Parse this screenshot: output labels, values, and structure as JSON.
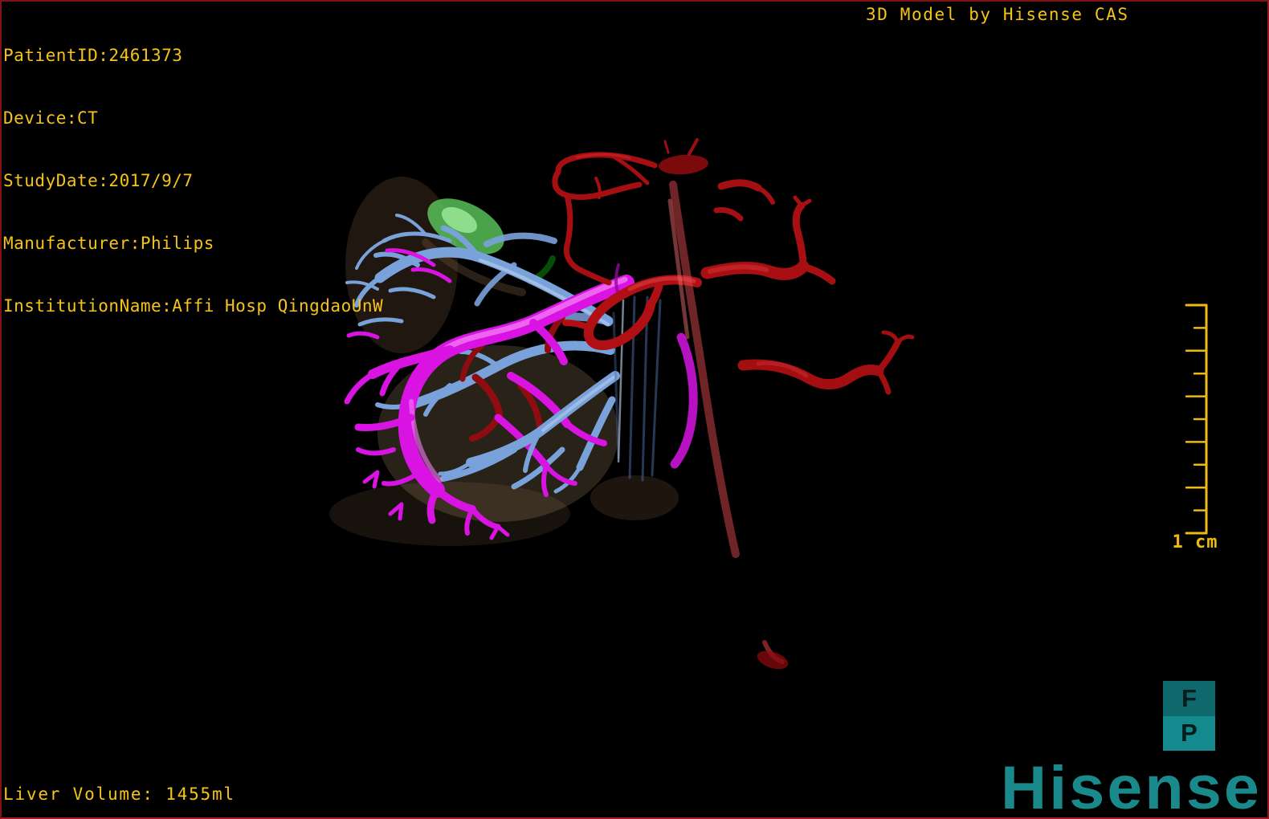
{
  "app": {
    "title_right": "3D Model by Hisense CAS"
  },
  "patient": {
    "patient_id_line": "PatientID:2461373",
    "device_line": "Device:CT",
    "study_date_line": "StudyDate:2017/9/7",
    "manufacturer_line": "Manufacturer:Philips",
    "institution_line": "InstitutionName:Affi Hosp QingdaoUnW"
  },
  "measurements": {
    "liver_volume_line": "Liver Volume: 1455ml"
  },
  "ruler": {
    "label": "1 cm",
    "tick_count": 11
  },
  "branding": {
    "fp_top": "F",
    "fp_bottom": "P",
    "wordmark": "Hisense"
  },
  "colors": {
    "background": "#000000",
    "frame_border": "#8a1316",
    "overlay_text": "#f5c31b",
    "ruler": "#efba13",
    "brand_teal": "#19898b",
    "fp_top_bg": "#0e686c",
    "fp_bottom_bg": "#148a8e",
    "liver": "#b18b61",
    "gallbladder": "#18a018",
    "portal_vein": "#d914e3",
    "hepatic_vein": "#7aa2da",
    "inferior_vena_cava": "#7ba3dc",
    "artery": "#b01014"
  },
  "model": {
    "description": "3D liver model with vasculature",
    "structures": [
      {
        "name": "liver",
        "color": "#b18b61"
      },
      {
        "name": "gallbladder",
        "color": "#18a018"
      },
      {
        "name": "portal-vein",
        "color": "#d914e3"
      },
      {
        "name": "hepatic-veins",
        "color": "#7aa2da"
      },
      {
        "name": "inferior-vena-cava",
        "color": "#7ba3dc"
      },
      {
        "name": "aorta-and-arteries",
        "color": "#b01014"
      }
    ]
  }
}
